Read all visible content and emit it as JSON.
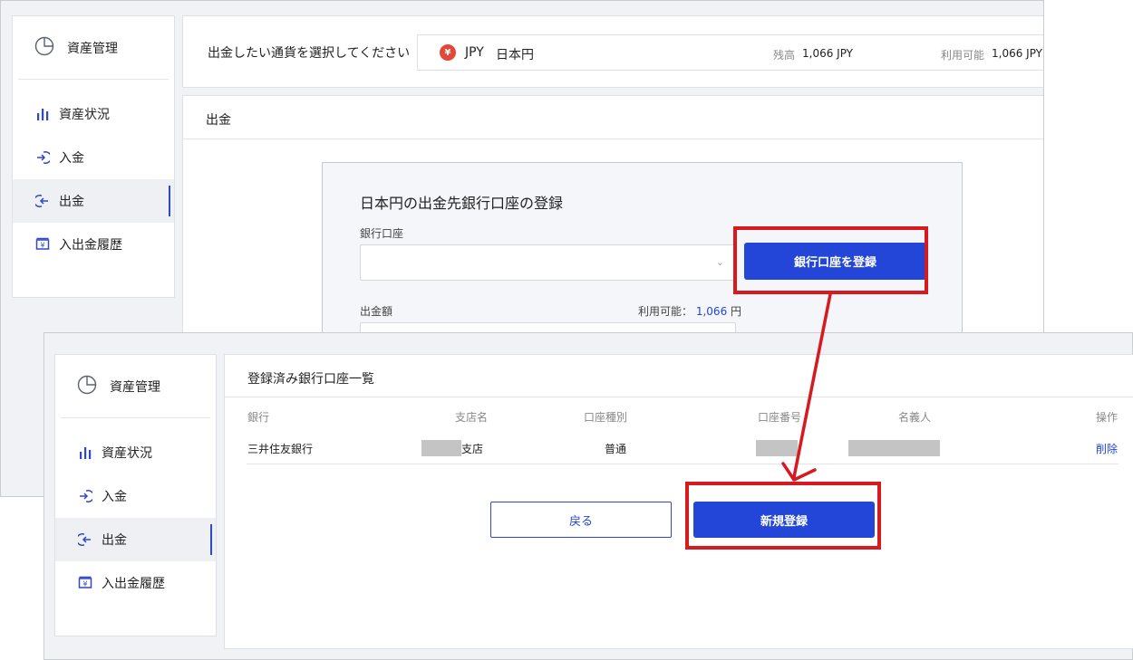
{
  "sidebar": {
    "title": "資産管理",
    "items": [
      {
        "label": "資産状況",
        "icon": "bar-chart-icon"
      },
      {
        "label": "入金",
        "icon": "deposit-arrow-icon"
      },
      {
        "label": "出金",
        "icon": "withdraw-arrow-icon",
        "active": true
      },
      {
        "label": "入出金履歴",
        "icon": "history-icon"
      }
    ]
  },
  "currency_bar": {
    "prompt": "出金したい通貨を選択してください",
    "currency_symbol": "¥",
    "currency_code": "JPY",
    "currency_name": "日本円",
    "balance_label": "残高",
    "balance_value": "1,066 JPY",
    "available_label": "利用可能",
    "available_value": "1,066 JPY"
  },
  "withdraw": {
    "title": "出金",
    "form_title": "日本円の出金先銀行口座の登録",
    "account_label": "銀行口座",
    "register_account_button": "銀行口座を登録",
    "amount_label": "出金額",
    "available_prefix": "利用可能：",
    "available_amount": "1,066",
    "available_unit": "円"
  },
  "account_list": {
    "title": "登録済み銀行口座一覧",
    "columns": [
      "銀行",
      "支店名",
      "口座種別",
      "口座番号",
      "名義人",
      "操作"
    ],
    "rows": [
      {
        "bank": "三井住友銀行",
        "branch_suffix": "支店",
        "type": "普通",
        "action": "削除"
      }
    ],
    "back_button": "戻る",
    "new_button": "新規登録"
  },
  "colors": {
    "accent": "#2345d8",
    "highlight": "#d61a1f",
    "yen_badge": "#e4473a"
  }
}
